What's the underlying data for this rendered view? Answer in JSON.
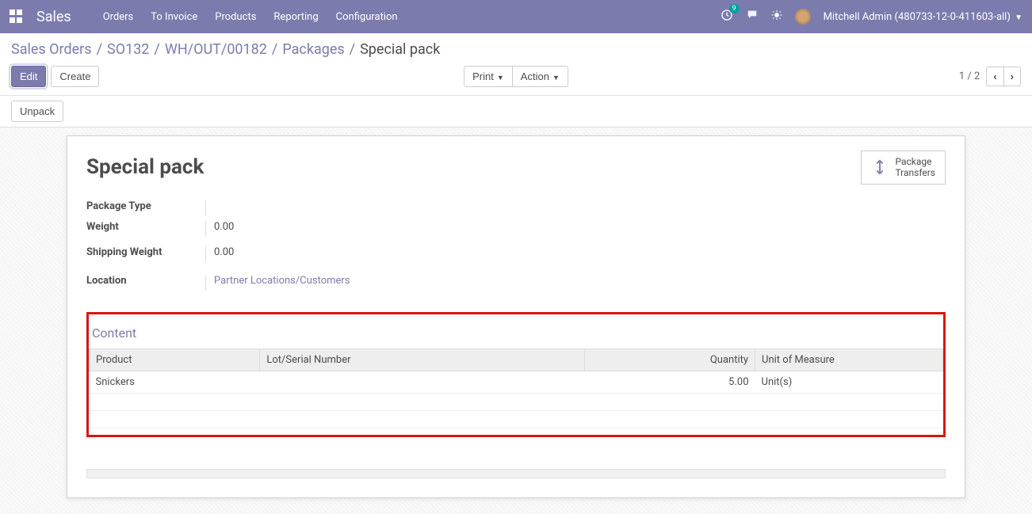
{
  "nav": {
    "brand": "Sales",
    "menu": [
      "Orders",
      "To Invoice",
      "Products",
      "Reporting",
      "Configuration"
    ],
    "badge_count": "9",
    "user": "Mitchell Admin (480733-12-0-411603-all)"
  },
  "breadcrumb": {
    "items": [
      "Sales Orders",
      "SO132",
      "WH/OUT/00182",
      "Packages"
    ],
    "current": "Special pack"
  },
  "buttons": {
    "edit": "Edit",
    "create": "Create",
    "print": "Print",
    "action": "Action",
    "unpack": "Unpack"
  },
  "pager": {
    "value": "1 / 2"
  },
  "stat_button": {
    "line1": "Package",
    "line2": "Transfers"
  },
  "form": {
    "title": "Special pack",
    "fields": {
      "package_type": {
        "label": "Package Type",
        "value": ""
      },
      "weight": {
        "label": "Weight",
        "value": "0.00"
      },
      "shipping_weight": {
        "label": "Shipping Weight",
        "value": "0.00"
      },
      "location": {
        "label": "Location",
        "value": "Partner Locations/Customers"
      }
    }
  },
  "content": {
    "title": "Content",
    "headers": {
      "product": "Product",
      "lot": "Lot/Serial Number",
      "quantity": "Quantity",
      "uom": "Unit of Measure"
    },
    "rows": [
      {
        "product": "Snickers",
        "lot": "",
        "quantity": "5.00",
        "uom": "Unit(s)"
      }
    ]
  }
}
